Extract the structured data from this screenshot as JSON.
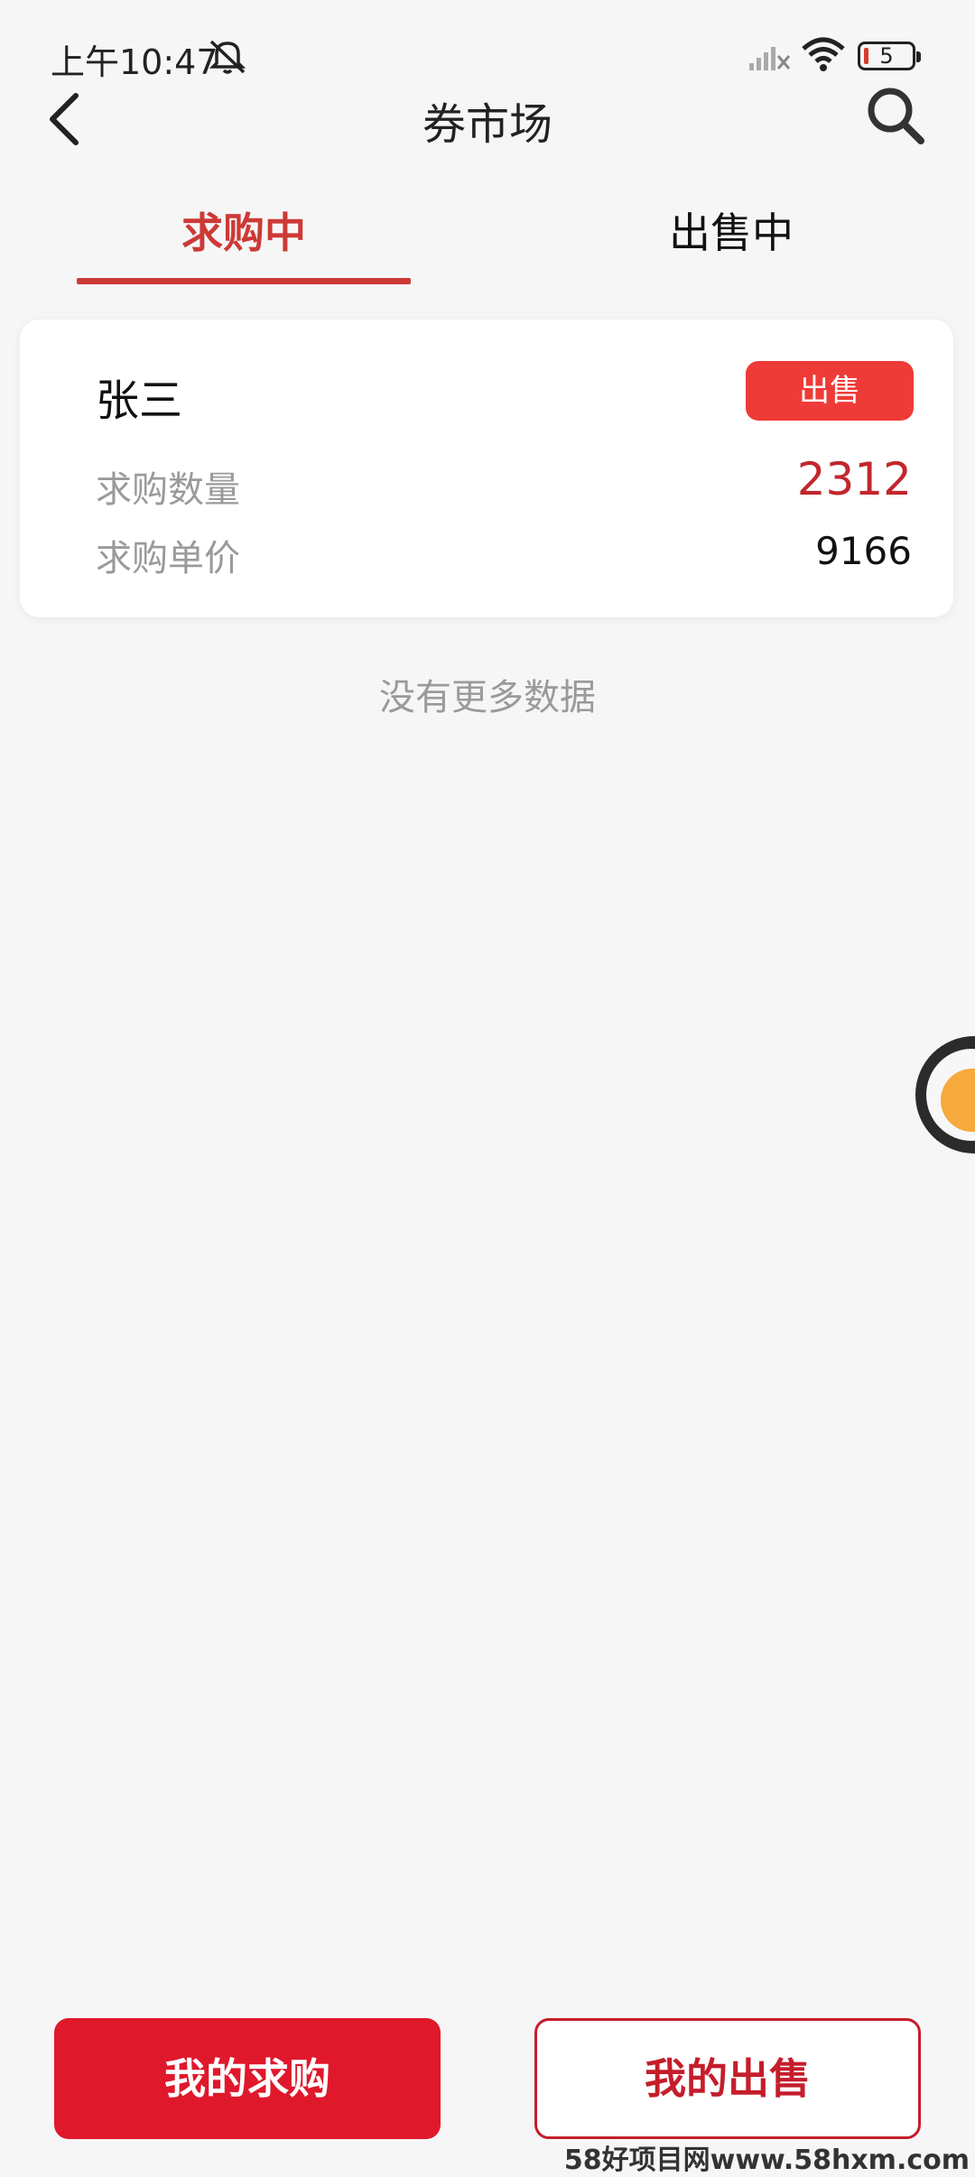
{
  "status_bar": {
    "time": "上午10:47",
    "battery": "5"
  },
  "header": {
    "title": "券市场"
  },
  "tabs": [
    {
      "label": "求购中",
      "active": true
    },
    {
      "label": "出售中",
      "active": false
    }
  ],
  "listings": [
    {
      "name": "张三",
      "action_label": "出售",
      "quantity_label": "求购数量",
      "quantity": "2312",
      "price_label": "求购单价",
      "price": "9166"
    }
  ],
  "empty_hint": "没有更多数据",
  "bottom": {
    "my_buy_label": "我的求购",
    "my_sell_label": "我的出售"
  },
  "watermark": "58好项目网www.58hxm.com",
  "colors": {
    "accent": "#cc3a36",
    "primary_button": "#e0182c",
    "sell_badge": "#ef3b37",
    "background": "#f6f6f7"
  }
}
